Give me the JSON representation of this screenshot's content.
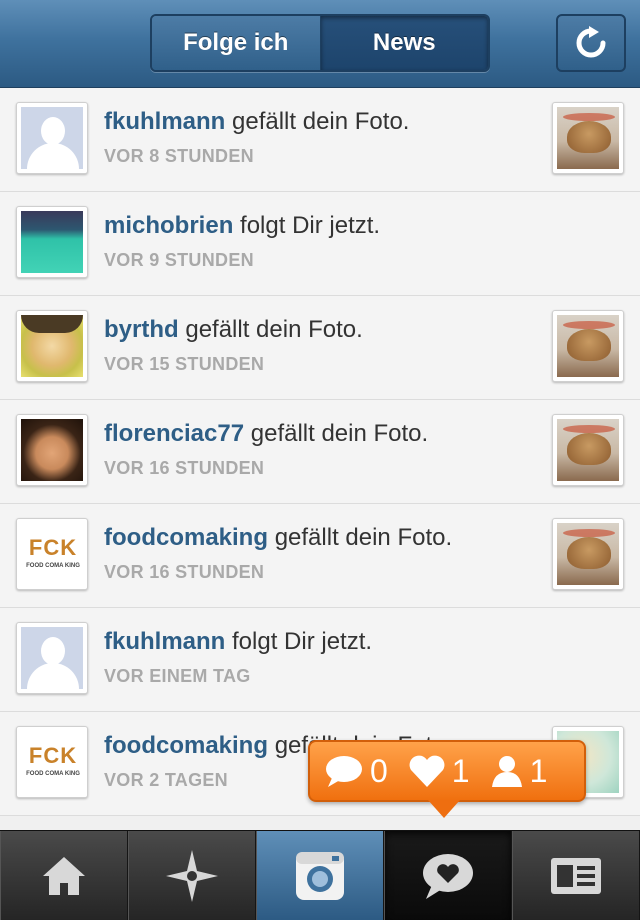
{
  "header": {
    "tab_following": "Folge ich",
    "tab_news": "News",
    "refresh_icon": "refresh-icon"
  },
  "activity": [
    {
      "username": "fkuhlmann",
      "action": "gefällt dein Foto.",
      "time": "VOR 8 STUNDEN",
      "avatar": "default-avatar",
      "thumb": "burger"
    },
    {
      "username": "michobrien",
      "action": "folgt Dir jetzt.",
      "time": "VOR 9 STUNDEN",
      "avatar": "pool",
      "thumb": ""
    },
    {
      "username": "byrthd",
      "action": "gefällt dein Foto.",
      "time": "VOR 15 STUNDEN",
      "avatar": "face",
      "thumb": "burger"
    },
    {
      "username": "florenciac77",
      "action": "gefällt dein Foto.",
      "time": "VOR 16 STUNDEN",
      "avatar": "girl",
      "thumb": "burger"
    },
    {
      "username": "foodcomaking",
      "action": "gefällt dein Foto.",
      "time": "VOR 16 STUNDEN",
      "avatar": "fck",
      "thumb": "burger"
    },
    {
      "username": "fkuhlmann",
      "action": "folgt Dir jetzt.",
      "time": "VOR EINEM TAG",
      "avatar": "default-avatar",
      "thumb": ""
    },
    {
      "username": "foodcomaking",
      "action": "gefällt dein Foto.",
      "time": "VOR 2 TAGEN",
      "avatar": "fck",
      "thumb": "pizza"
    }
  ],
  "fck_logo": {
    "text": "FCK",
    "sub": "FOOD COMA KING"
  },
  "notification": {
    "comments": "0",
    "likes": "1",
    "followers": "1",
    "color": "#f0700f"
  },
  "tabbar": {
    "tabs": [
      "home-icon",
      "explore-icon",
      "camera-icon",
      "news-icon",
      "profile-icon"
    ],
    "active": "news-icon"
  }
}
